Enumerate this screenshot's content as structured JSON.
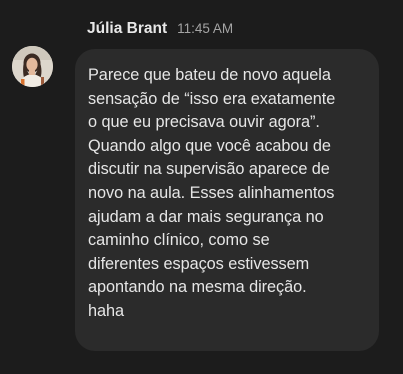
{
  "message": {
    "sender_name": "Júlia Brant",
    "time": "11:45 AM",
    "avatar_icon": "user-photo-avatar",
    "text": "Parece que bateu de novo aquela\nsensação de “isso era exatamente\no que eu precisava ouvir agora”.\nQuando algo que você acabou de\ndiscutir na supervisão aparece de\nnovo na aula. Esses alinhamentos\najudam a dar mais segurança no\ncaminho clínico, como se\ndiferentes espaços estivessem\napontando na mesma direção.\nhaha"
  },
  "colors": {
    "background": "#1c1c1c",
    "bubble": "#2b2b2b",
    "text": "#e6e6e6",
    "name": "#e8e8e8",
    "timestamp": "#a4a4a4"
  }
}
